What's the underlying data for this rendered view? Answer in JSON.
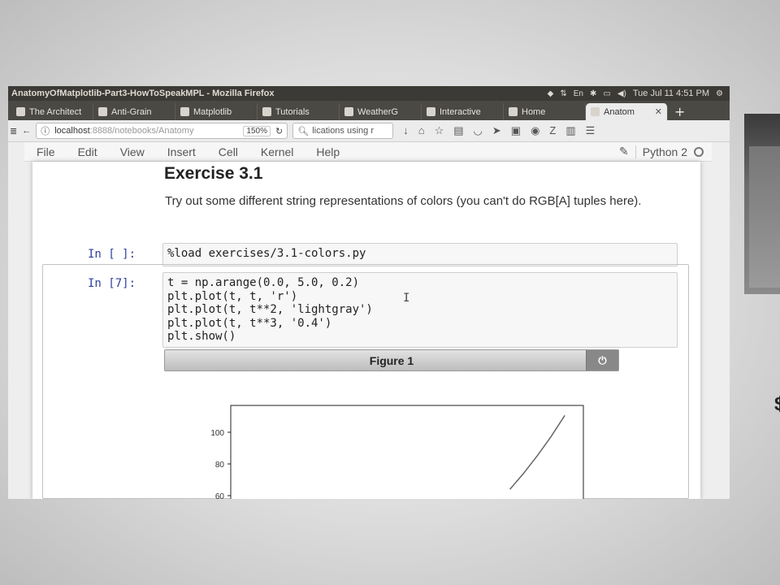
{
  "window": {
    "title": "AnatomyOfMatplotlib-Part3-HowToSpeakMPL - Mozilla Firefox",
    "clock": "Tue Jul 11 4:51 PM"
  },
  "tabs": [
    {
      "label": "The Architect"
    },
    {
      "label": "Anti-Grain"
    },
    {
      "label": "Matplotlib"
    },
    {
      "label": "Tutorials"
    },
    {
      "label": "WeatherG"
    },
    {
      "label": "Interactive"
    },
    {
      "label": "Home"
    },
    {
      "label": "Anatom"
    }
  ],
  "navbar": {
    "url_host": "localhost",
    "url_path": ":8888/notebooks/Anatomy",
    "zoom": "150%",
    "search_text": "lications using r"
  },
  "menu": {
    "items": [
      "File",
      "Edit",
      "View",
      "Insert",
      "Cell",
      "Kernel",
      "Help"
    ],
    "kernel_name": "Python 2"
  },
  "notebook": {
    "heading": "Exercise 3.1",
    "description": "Try out some different string representations of colors (you can't do RGB[A] tuples here).",
    "cell1_prompt": "In [ ]:",
    "cell1_code": "%load exercises/3.1-colors.py",
    "cell2_prompt": "In [7]:",
    "cell2_lines": [
      "t = np.arange(0.0, 5.0, 0.2)",
      "plt.plot(t, t, 'r')",
      "plt.plot(t, t**2, 'lightgray')",
      "plt.plot(t, t**3, '0.4')",
      "plt.show()"
    ],
    "cursor_glyph": "I",
    "figure_title": "Figure 1",
    "figure_button_icon": "power-icon"
  },
  "chart_data": {
    "type": "line",
    "title": "",
    "xlabel": "",
    "ylabel": "",
    "yticks": [
      60,
      80,
      100
    ],
    "ylim": [
      60,
      115
    ],
    "xlim": [
      0,
      5
    ],
    "series": [
      {
        "color": "#666666",
        "x": [
          4.0,
          4.2,
          4.4,
          4.6,
          4.8
        ],
        "y": [
          64,
          74.1,
          85.2,
          97.3,
          110.6
        ]
      }
    ]
  }
}
